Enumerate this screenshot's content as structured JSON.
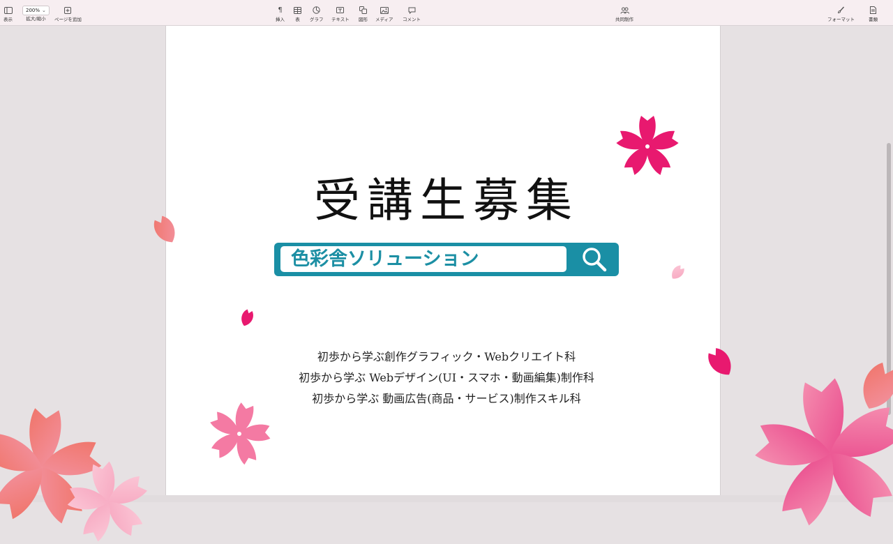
{
  "toolbar": {
    "view_label": "表示",
    "zoom_value": "200%",
    "zoom_label": "拡大/縮小",
    "add_page_label": "ページを追加",
    "insert_label": "挿入",
    "table_label": "表",
    "chart_label": "グラフ",
    "text_label": "テキスト",
    "shape_label": "図形",
    "media_label": "メディア",
    "comment_label": "コメント",
    "collaborate_label": "共同制作",
    "format_label": "フォーマット",
    "document_label": "書類"
  },
  "icons": {
    "view": "sidebar-icon",
    "add_page": "plus-square-icon",
    "insert": "pilcrow-icon",
    "table": "table-icon",
    "chart": "pie-chart-icon",
    "text": "text-box-icon",
    "shape": "shape-icon",
    "media": "image-icon",
    "comment": "comment-bubble-icon",
    "collaborate": "people-icon",
    "format": "paintbrush-icon",
    "document": "document-icon",
    "search": "magnifier-icon"
  },
  "document": {
    "headline": "受講生募集",
    "search_text": "色彩舎ソリューション",
    "courses": [
      "初歩から学ぶ創作グラフィック・Webクリエイト科",
      "初歩から学ぶ Webデザイン(UI・スマホ・動画編集)制作科",
      "初歩から学ぶ 動画広告(商品・サービス)制作スキル科"
    ]
  },
  "colors": {
    "search_bar": "#1a8fa5",
    "sakura_magenta": "#e8196f",
    "sakura_pink": "#f47aa3",
    "sakura_coral": "#f0756a",
    "toolbar_bg": "#f7eef1"
  }
}
